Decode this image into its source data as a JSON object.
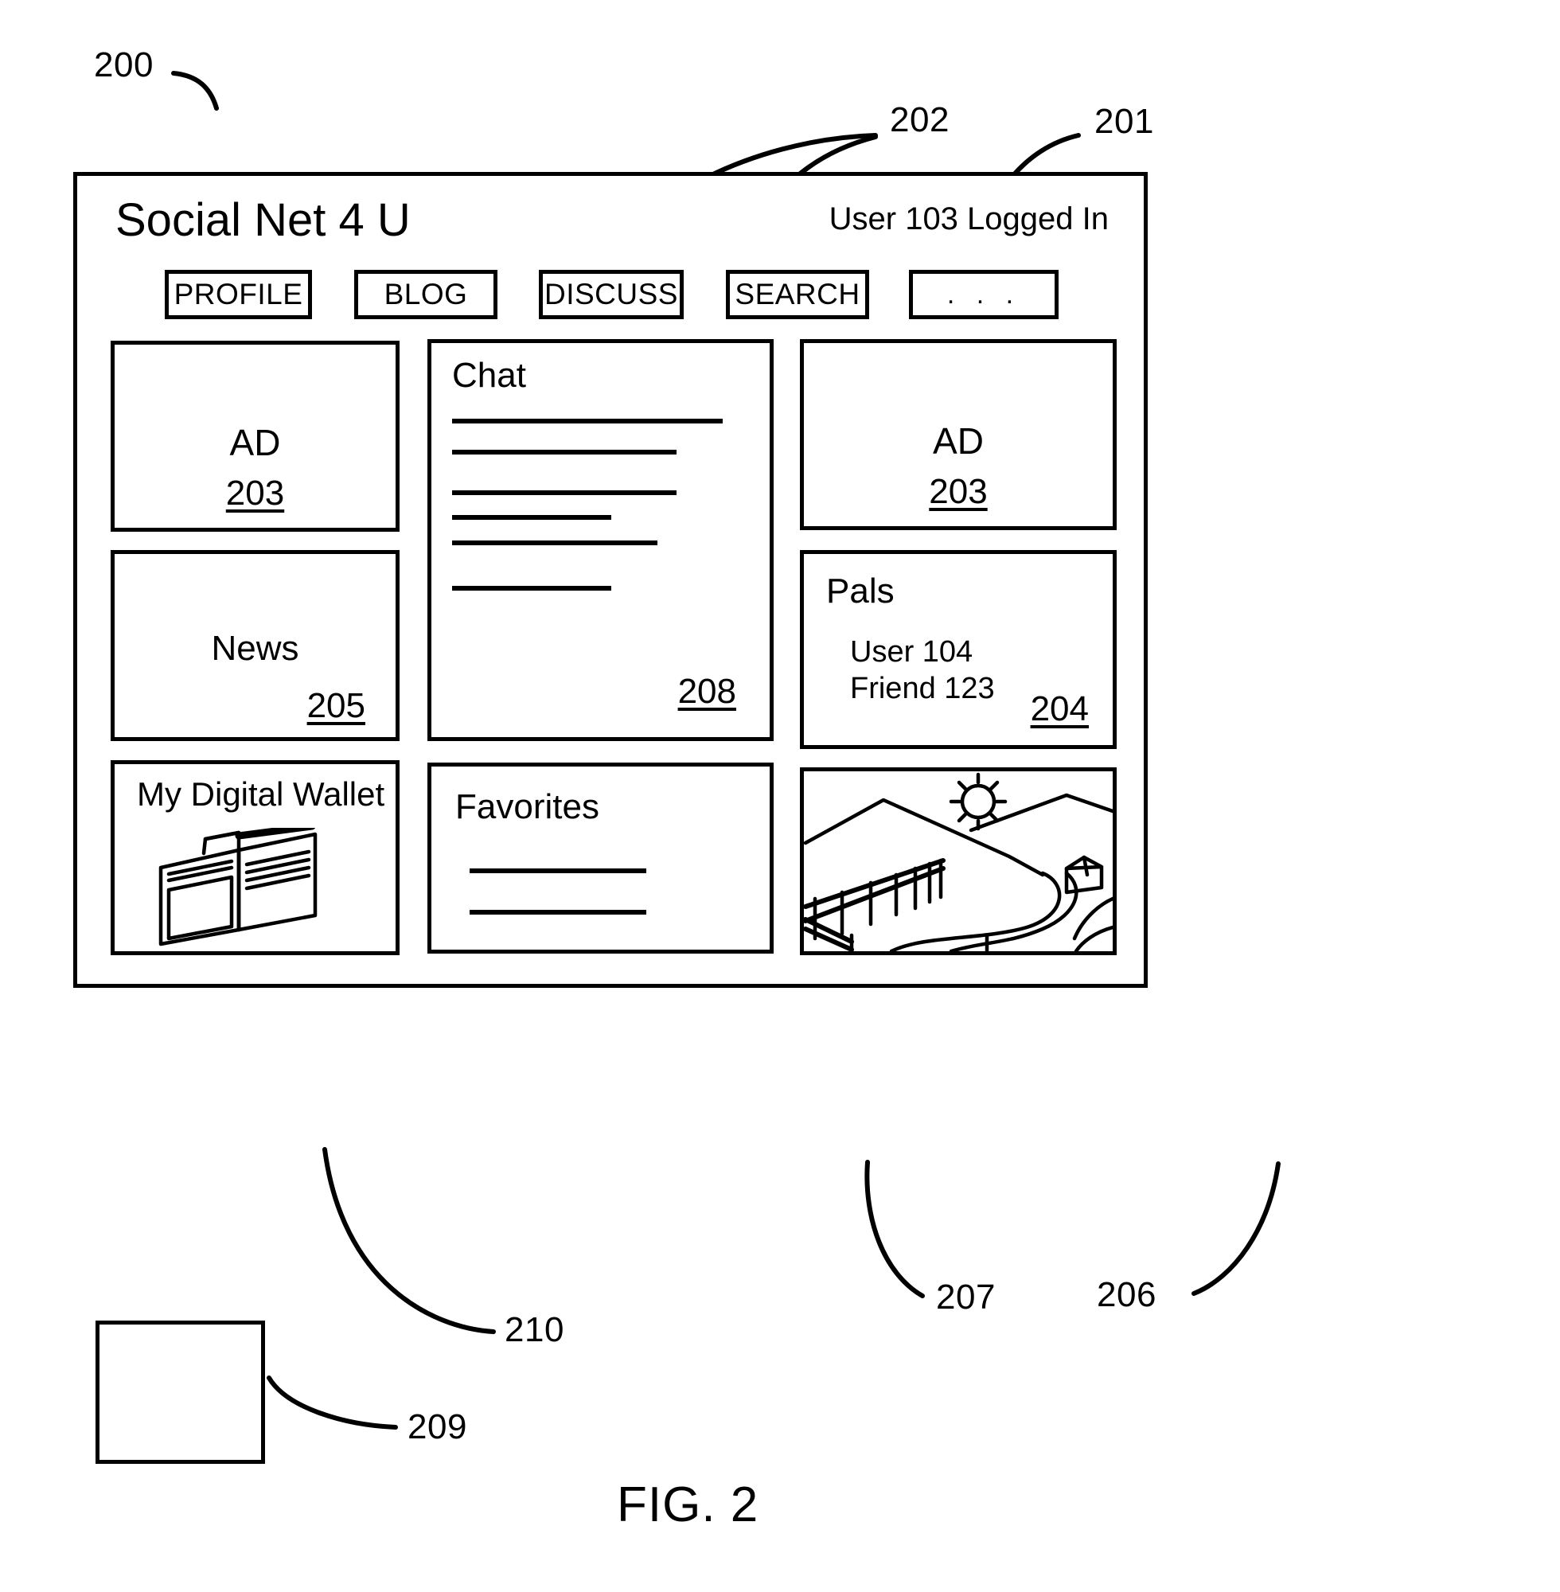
{
  "figure": {
    "caption": "FIG. 2",
    "root_ref": "200"
  },
  "callouts": [
    {
      "id": "ref-202",
      "label": "202"
    },
    {
      "id": "ref-201",
      "label": "201"
    },
    {
      "id": "ref-210",
      "label": "210"
    },
    {
      "id": "ref-209",
      "label": "209"
    },
    {
      "id": "ref-207",
      "label": "207"
    },
    {
      "id": "ref-206",
      "label": "206"
    }
  ],
  "header": {
    "site_title": "Social Net 4 U",
    "login_status": "User 103 Logged In"
  },
  "nav": {
    "buttons": [
      {
        "label": "PROFILE",
        "name": "nav-profile"
      },
      {
        "label": "BLOG",
        "name": "nav-blog"
      },
      {
        "label": "DISCUSS",
        "name": "nav-discuss"
      },
      {
        "label": "SEARCH",
        "name": "nav-search"
      },
      {
        "label": ". . .",
        "name": "nav-more"
      }
    ]
  },
  "panels": {
    "ad_top": {
      "label": "AD",
      "ref": "203"
    },
    "ad_right": {
      "label": "AD",
      "ref": "203"
    },
    "news": {
      "label": "News",
      "ref": "205"
    },
    "chat": {
      "title": "Chat",
      "ref": "208"
    },
    "pals": {
      "title": "Pals",
      "ref": "204",
      "members": [
        "User 104",
        "Friend 123"
      ]
    },
    "wallet": {
      "title": "My Digital Wallet",
      "ref": "210",
      "icon": "wallet-illustration"
    },
    "favorites": {
      "title": "Favorites",
      "ref": "207"
    },
    "photo": {
      "ref": "206",
      "icon": "landscape-illustration"
    }
  },
  "chart_data": {
    "type": "table",
    "title": "Social Net 4 U page layout (FIG. 2)",
    "categories": [
      "AD",
      "Chat",
      "AD",
      "News",
      "Pals",
      "My Digital Wallet",
      "Favorites",
      "Photo"
    ],
    "values": [
      203,
      208,
      203,
      205,
      204,
      210,
      207,
      206
    ]
  }
}
